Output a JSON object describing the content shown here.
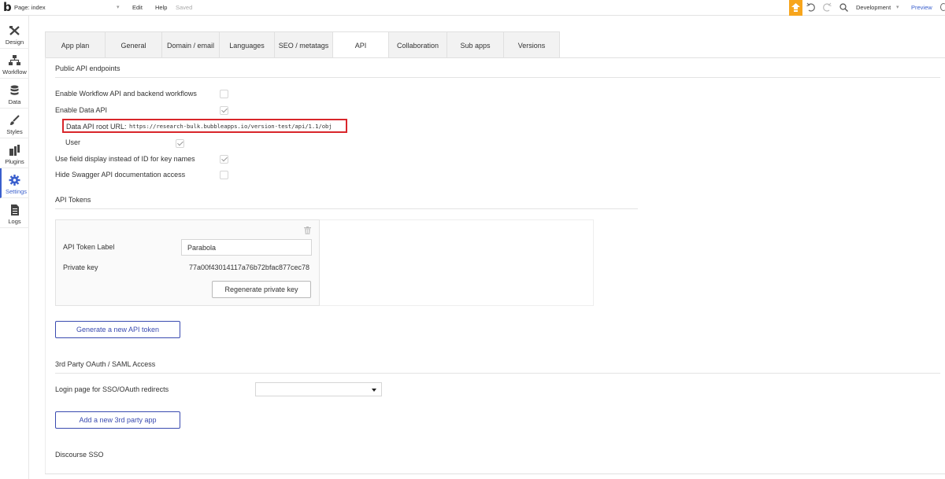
{
  "topbar": {
    "logo": "b",
    "page_label": "Page: index",
    "edit": "Edit",
    "help": "Help",
    "saved": "Saved",
    "environment": "Development",
    "preview": "Preview"
  },
  "sidebar": {
    "items": [
      {
        "label": "Design",
        "icon": "design-icon"
      },
      {
        "label": "Workflow",
        "icon": "workflow-icon"
      },
      {
        "label": "Data",
        "icon": "database-icon"
      },
      {
        "label": "Styles",
        "icon": "brush-icon"
      },
      {
        "label": "Plugins",
        "icon": "plugin-icon"
      },
      {
        "label": "Settings",
        "icon": "gear-icon",
        "active": true
      },
      {
        "label": "Logs",
        "icon": "logs-icon"
      }
    ]
  },
  "tabs": [
    {
      "label": "App plan"
    },
    {
      "label": "General"
    },
    {
      "label": "Domain / email"
    },
    {
      "label": "Languages"
    },
    {
      "label": "SEO / metatags"
    },
    {
      "label": "API",
      "active": true
    },
    {
      "label": "Collaboration"
    },
    {
      "label": "Sub apps"
    },
    {
      "label": "Versions"
    }
  ],
  "api": {
    "public_title": "Public API endpoints",
    "enable_workflow": {
      "label": "Enable Workflow API and backend workflows",
      "checked": false
    },
    "enable_data": {
      "label": "Enable Data API",
      "checked": true
    },
    "root_url_label": "Data API root URL:",
    "root_url_value": "https://research-bulk.bubbleapps.io/version-test/api/1.1/obj",
    "user": {
      "label": "User",
      "checked": true
    },
    "field_display": {
      "label": "Use field display instead of ID for key names",
      "checked": true
    },
    "hide_swagger": {
      "label": "Hide Swagger API documentation access",
      "checked": false
    }
  },
  "tokens": {
    "title": "API Tokens",
    "token_label_caption": "API Token Label",
    "token_label_value": "Parabola",
    "private_key_caption": "Private key",
    "private_key_value": "77a00f43014117a76b72bfac877cec78",
    "regenerate": "Regenerate private key",
    "generate": "Generate a new API token"
  },
  "oauth": {
    "title": "3rd Party OAuth / SAML Access",
    "login_page_label": "Login page for SSO/OAuth redirects",
    "login_page_value": "",
    "add_app": "Add a new 3rd party app"
  },
  "discourse": {
    "title": "Discourse SSO"
  },
  "colors": {
    "accent": "#3a4bb0",
    "upgrade": "#f7a51c",
    "highlight": "#d9262b"
  }
}
